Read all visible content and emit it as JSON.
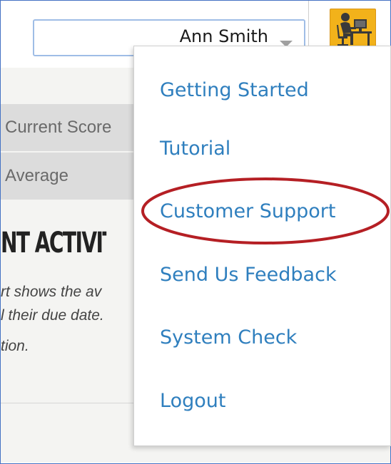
{
  "header": {
    "user_name": "Ann Smith",
    "user_select_icon": "chevron-down-icon",
    "avatar_icon": "person-at-desk-icon"
  },
  "background": {
    "score_rows": [
      "Current Score",
      "Average"
    ],
    "activity_title": "NT ACTIVITY",
    "activity_lines": [
      "rt shows the av",
      "l their due date.",
      "tion."
    ]
  },
  "menu": {
    "items": [
      {
        "label": "Getting Started"
      },
      {
        "label": "Tutorial"
      },
      {
        "label": "Customer Support"
      },
      {
        "label": "Send Us Feedback"
      },
      {
        "label": "System Check"
      },
      {
        "label": "Logout"
      }
    ],
    "highlighted_item": "Customer Support",
    "annotation_color": "#b51f24"
  },
  "colors": {
    "menu_link": "#2f7fbe",
    "frame_border": "#4472c4",
    "avatar_bg": "#f2b21a"
  }
}
